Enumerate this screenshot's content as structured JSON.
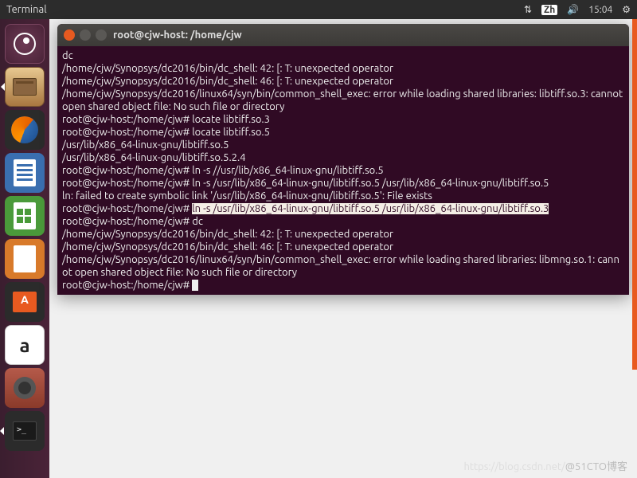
{
  "topbar": {
    "title": "Terminal",
    "lang": "Zh",
    "time": "15:04"
  },
  "launcher": [
    "dash",
    "files",
    "firefox",
    "writer",
    "calc",
    "impress",
    "store",
    "amazon",
    "settings",
    "terminal"
  ],
  "window": {
    "title": "root@cjw-host: /home/cjw"
  },
  "term": {
    "l0": "dc",
    "l1": "/home/cjw/Synopsys/dc2016/bin/dc_shell: 42: [: T: unexpected operator",
    "l2": "/home/cjw/Synopsys/dc2016/bin/dc_shell: 46: [: T: unexpected operator",
    "l3": "/home/cjw/Synopsys/dc2016/linux64/syn/bin/common_shell_exec: error while loading shared libraries: libtiff.so.3: cannot open shared object file: No such file or directory",
    "l4": "root@cjw-host:/home/cjw# locate libtiff.so.3",
    "l5": "root@cjw-host:/home/cjw# locate libtiff.so.5",
    "l6": "/usr/lib/x86_64-linux-gnu/libtiff.so.5",
    "l7": "/usr/lib/x86_64-linux-gnu/libtiff.so.5.2.4",
    "l8": "root@cjw-host:/home/cjw# ln -s //usr/lib/x86_64-linux-gnu/libtiff.so.5",
    "l9": "root@cjw-host:/home/cjw# ln -s /usr/lib/x86_64-linux-gnu/libtiff.so.5 /usr/lib/x86_64-linux-gnu/libtiff.so.5",
    "l10": "ln: failed to create symbolic link '/usr/lib/x86_64-linux-gnu/libtiff.so.5': File exists",
    "l11a": "root@cjw-host:/home/cjw# ",
    "l11b": "ln -s /usr/lib/x86_64-linux-gnu/libtiff.so.5 /usr/lib/x86_64-linux-gnu/libtiff.so.3",
    "l12": "root@cjw-host:/home/cjw# dc",
    "l13": "/home/cjw/Synopsys/dc2016/bin/dc_shell: 42: [: T: unexpected operator",
    "l14": "/home/cjw/Synopsys/dc2016/bin/dc_shell: 46: [: T: unexpected operator",
    "l15": "/home/cjw/Synopsys/dc2016/linux64/syn/bin/common_shell_exec: error while loading shared libraries: libmng.so.1: cannot open shared object file: No such file or directory",
    "l16": "root@cjw-host:/home/cjw# "
  },
  "watermark": {
    "faint": "https://blog.csdn.net/",
    "main": "@51CTO博客"
  }
}
